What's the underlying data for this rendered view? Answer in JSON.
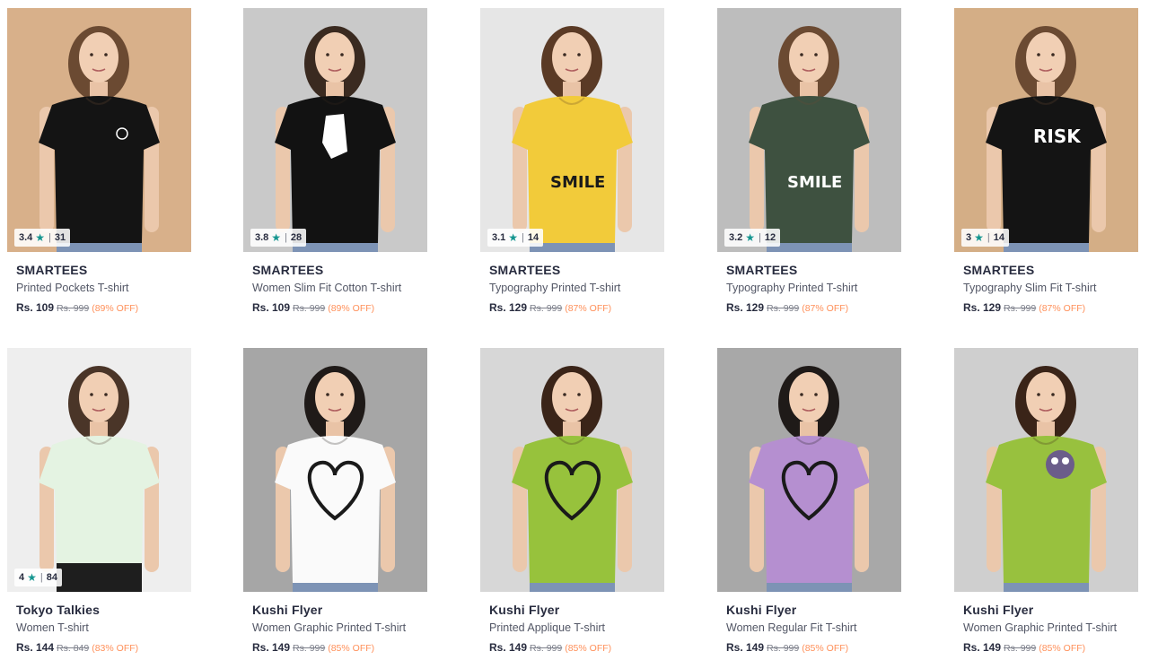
{
  "products": [
    {
      "brand": "SMARTEES",
      "name": "Printed Pockets T-shirt",
      "price": "Rs. 109",
      "mrp": "Rs. 999",
      "discount": "(89% OFF)",
      "rating": "3.4",
      "rating_count": "31",
      "colors": {
        "bg": "#d8b08a",
        "shirt": "#141414",
        "hair": "#6b4a32",
        "print": "#ffffff"
      },
      "print_text": ""
    },
    {
      "brand": "SMARTEES",
      "name": "Women Slim Fit Cotton T-shirt",
      "price": "Rs. 109",
      "mrp": "Rs. 999",
      "discount": "(89% OFF)",
      "rating": "3.8",
      "rating_count": "28",
      "colors": {
        "bg": "#c9c9c9",
        "shirt": "#121212",
        "hair": "#3a2a20",
        "print": "#ffffff"
      },
      "print_text": ""
    },
    {
      "brand": "SMARTEES",
      "name": "Typography Printed T-shirt",
      "price": "Rs. 129",
      "mrp": "Rs. 999",
      "discount": "(87% OFF)",
      "rating": "3.1",
      "rating_count": "14",
      "colors": {
        "bg": "#e6e6e6",
        "shirt": "#f2cb3a",
        "hair": "#5a3a25",
        "print": "#1a1a1a"
      },
      "print_text": "SMILE"
    },
    {
      "brand": "SMARTEES",
      "name": "Typography Printed T-shirt",
      "price": "Rs. 129",
      "mrp": "Rs. 999",
      "discount": "(87% OFF)",
      "rating": "3.2",
      "rating_count": "12",
      "colors": {
        "bg": "#bdbdbd",
        "shirt": "#3e5140",
        "hair": "#6b4a32",
        "print": "#ffffff"
      },
      "print_text": "SMILE"
    },
    {
      "brand": "SMARTEES",
      "name": "Typography Slim Fit T-shirt",
      "price": "Rs. 129",
      "mrp": "Rs. 999",
      "discount": "(87% OFF)",
      "rating": "3",
      "rating_count": "14",
      "colors": {
        "bg": "#d4ae86",
        "shirt": "#141414",
        "hair": "#6b4a32",
        "print": "#ffffff"
      },
      "print_text": "RISK"
    },
    {
      "brand": "Tokyo Talkies",
      "name": "Women T-shirt",
      "price": "Rs. 144",
      "mrp": "Rs. 849",
      "discount": "(83% OFF)",
      "rating": "4",
      "rating_count": "84",
      "colors": {
        "bg": "#eeeeee",
        "shirt": "#e4f3e2",
        "hair": "#4a3528",
        "print": "#e4f3e2"
      },
      "print_text": ""
    },
    {
      "brand": "Kushi Flyer",
      "name": "Women Graphic Printed T-shirt",
      "price": "Rs. 149",
      "mrp": "Rs. 999",
      "discount": "(85% OFF)",
      "rating": "",
      "rating_count": "",
      "colors": {
        "bg": "#a6a6a6",
        "shirt": "#fafafa",
        "hair": "#1f1a18",
        "print": "#1a1a1a"
      },
      "print_text": ""
    },
    {
      "brand": "Kushi Flyer",
      "name": "Printed Applique T-shirt",
      "price": "Rs. 149",
      "mrp": "Rs. 999",
      "discount": "(85% OFF)",
      "rating": "",
      "rating_count": "",
      "colors": {
        "bg": "#d7d7d7",
        "shirt": "#97c23c",
        "hair": "#3a2418",
        "print": "#1a1a1a"
      },
      "print_text": ""
    },
    {
      "brand": "Kushi Flyer",
      "name": "Women Regular Fit T-shirt",
      "price": "Rs. 149",
      "mrp": "Rs. 999",
      "discount": "(85% OFF)",
      "rating": "",
      "rating_count": "",
      "colors": {
        "bg": "#a8a8a8",
        "shirt": "#b58fd0",
        "hair": "#1f1a18",
        "print": "#1a1a1a"
      },
      "print_text": ""
    },
    {
      "brand": "Kushi Flyer",
      "name": "Women Graphic Printed T-shirt",
      "price": "Rs. 149",
      "mrp": "Rs. 999",
      "discount": "(85% OFF)",
      "rating": "",
      "rating_count": "",
      "colors": {
        "bg": "#cfcfcf",
        "shirt": "#98c13e",
        "hair": "#3a2418",
        "print": "#5a4a7a"
      },
      "print_text": ""
    }
  ],
  "icons": {
    "star": "star-icon"
  }
}
